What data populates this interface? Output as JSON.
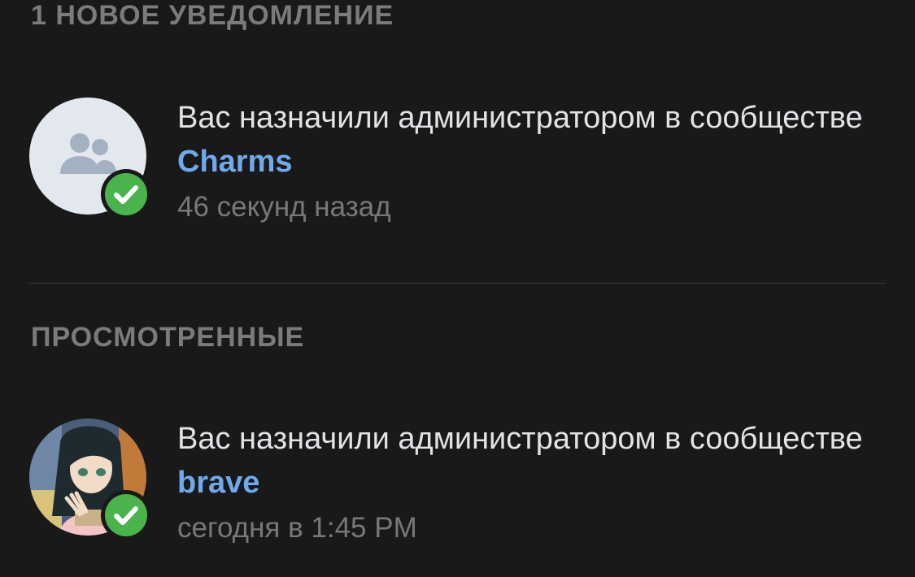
{
  "sections": {
    "new": {
      "title": "1 НОВОЕ УВЕДОМЛЕНИЕ"
    },
    "viewed": {
      "title": "ПРОСМОТРЕННЫЕ"
    }
  },
  "notifications": [
    {
      "text": "Вас назначили администратором в сообществе ",
      "group": "Charms",
      "time": "46 секунд назад",
      "avatar": "community-placeholder-icon",
      "badge": "checkmark-icon"
    },
    {
      "text": "Вас назначили администратором в сообществе ",
      "group": "brave",
      "time": "сегодня в 1:45 PM",
      "avatar": "anime-girl-avatar",
      "badge": "checkmark-icon"
    }
  ],
  "colors": {
    "background": "#19191a",
    "link": "#71aaeb",
    "badge": "#4bb34b",
    "header": "#7b7b7e",
    "text": "#e1e3e6",
    "secondary": "#76787a"
  }
}
